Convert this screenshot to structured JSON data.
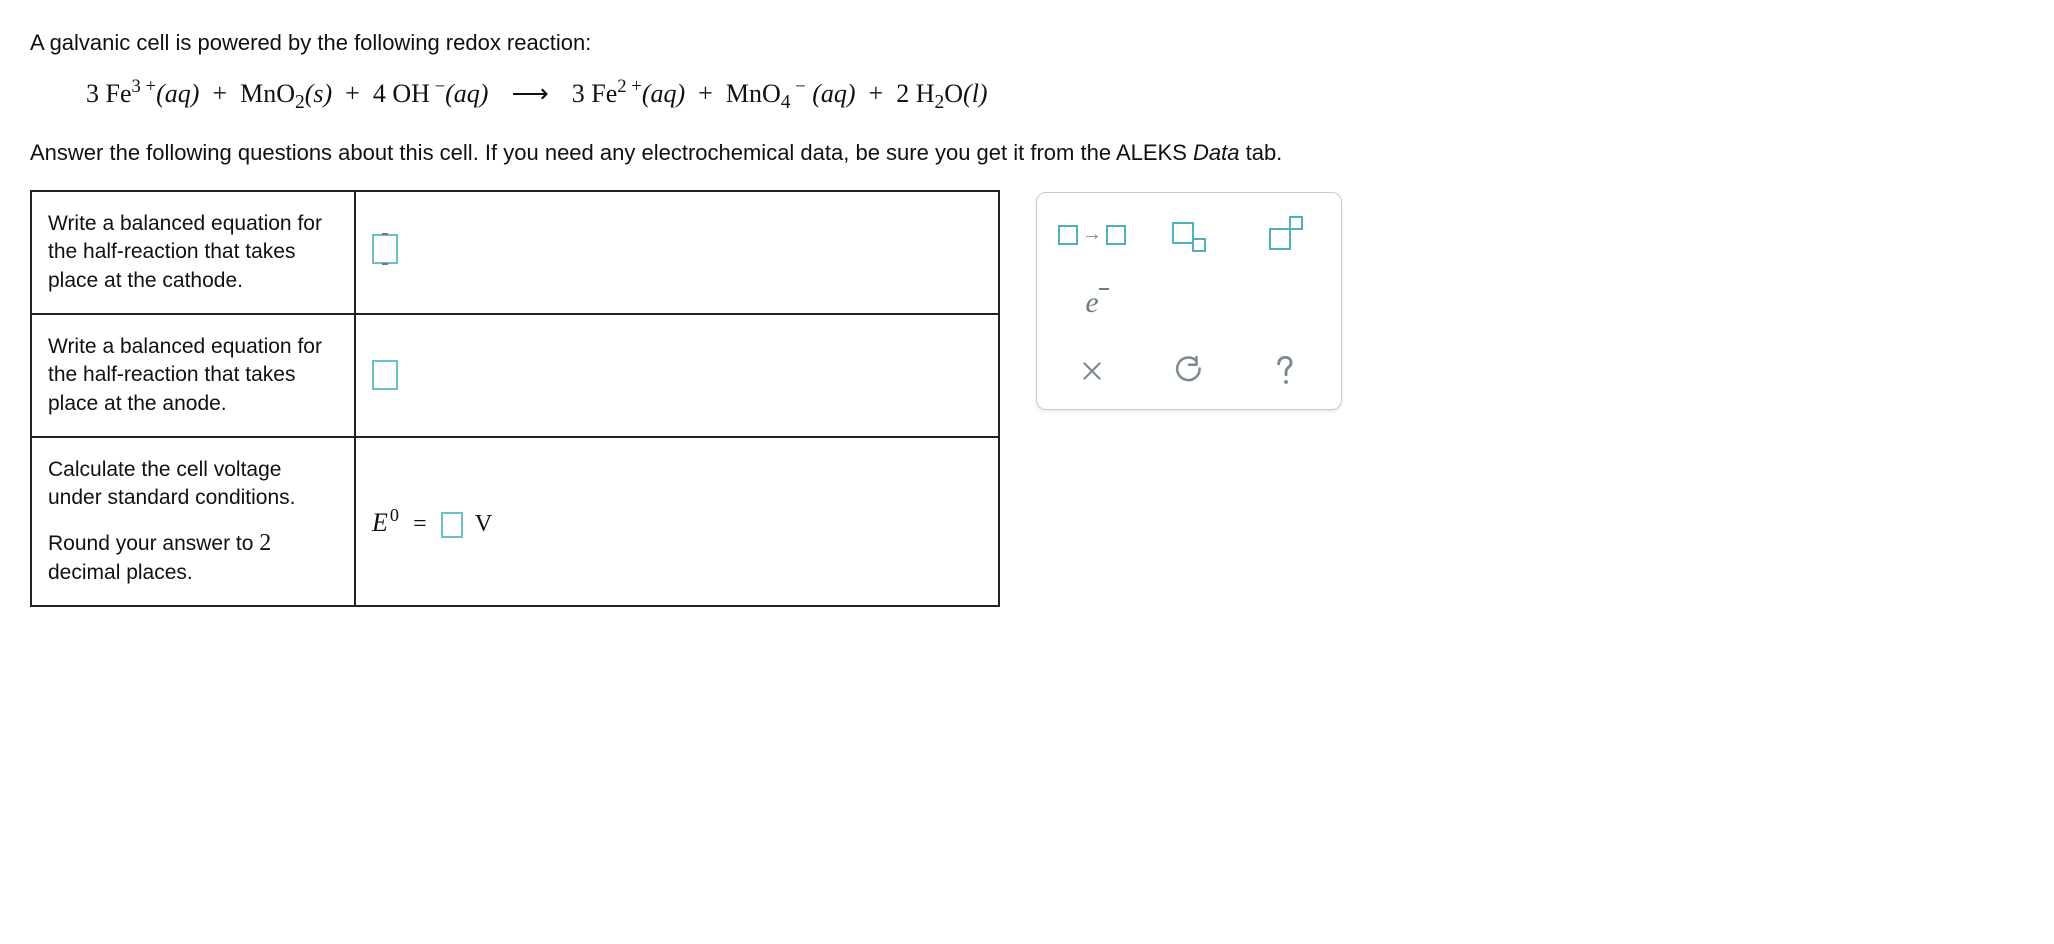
{
  "intro": "A galvanic cell is powered by the following redox reaction:",
  "equation": {
    "lhs": [
      {
        "coef": "3",
        "sym": "Fe",
        "sup": "3+",
        "state": "(aq)"
      },
      {
        "sym": "MnO",
        "sub": "2",
        "state": "(s)"
      },
      {
        "coef": "4",
        "sym": "OH",
        "sup": "−",
        "state": "(aq)"
      }
    ],
    "rhs": [
      {
        "coef": "3",
        "sym": "Fe",
        "sup": "2+",
        "state": "(aq)"
      },
      {
        "sym": "MnO",
        "sub": "4",
        "sup": "−",
        "state": "(aq)"
      },
      {
        "coef": "2",
        "sym": "H",
        "sub": "2",
        "tail": "O",
        "state": "(l)"
      }
    ]
  },
  "instruction_pre": "Answer the following questions about this cell. If you need any electrochemical data, be sure you get it from the ALEKS ",
  "instruction_italic": "Data",
  "instruction_post": " tab.",
  "rows": {
    "cathode": "Write a balanced equation for the half-reaction that takes place at the cathode.",
    "anode": "Write a balanced equation for the half-reaction that takes place at the anode.",
    "voltage_a": "Calculate the cell voltage under standard conditions.",
    "voltage_b_pre": "Round your answer to ",
    "voltage_b_num": "2",
    "voltage_b_post": " decimal places."
  },
  "e0": {
    "symbol": "E",
    "sup": "0",
    "eq": "=",
    "unit": "V"
  },
  "toolbox": {
    "yields": "reaction-arrow",
    "subscript": "subscript",
    "superscript": "superscript",
    "electron": "e",
    "clear": "clear",
    "reset": "reset",
    "help": "help"
  }
}
